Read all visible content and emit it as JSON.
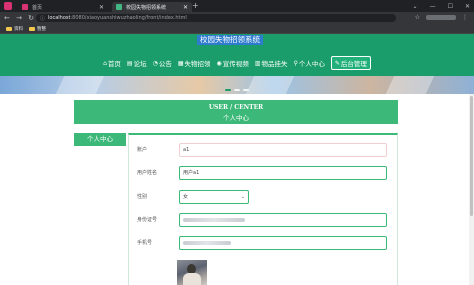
{
  "browser": {
    "tabs": [
      {
        "label": "首页",
        "favicon_color": "#d93275"
      },
      {
        "label": "校园失物招领系统",
        "favicon_color": "#41b883"
      }
    ],
    "url_host": "localhost",
    "url_path": ":8080/xiaoyuanshiwuzhaoling/front/index.html",
    "bookmarks": [
      "资料",
      "暂整"
    ]
  },
  "site": {
    "title": "校园失物招领系统",
    "nav": [
      {
        "label": "首页",
        "icon": "home-icon"
      },
      {
        "label": "论坛",
        "icon": "forum-icon"
      },
      {
        "label": "公告",
        "icon": "notice-icon"
      },
      {
        "label": "失物招领",
        "icon": "lost-found-icon"
      },
      {
        "label": "宣传视频",
        "icon": "video-icon"
      },
      {
        "label": "物品挂失",
        "icon": "report-icon"
      },
      {
        "label": "个人中心",
        "icon": "user-icon"
      },
      {
        "label": "后台管理",
        "icon": "admin-icon"
      }
    ]
  },
  "user_center": {
    "title_en": "USER / CENTER",
    "title_cn": "个人中心",
    "side_tab": "个人中心"
  },
  "form": {
    "account_label": "账户",
    "account_value": "a1",
    "name_label": "用户姓名",
    "name_value": "用户a1",
    "gender_label": "性别",
    "gender_value": "女",
    "id_label": "身份证号",
    "phone_label": "手机号"
  },
  "colors": {
    "primary": "#1a9d6a",
    "accent": "#3cb878",
    "title_highlight": "#2f7ccf"
  }
}
